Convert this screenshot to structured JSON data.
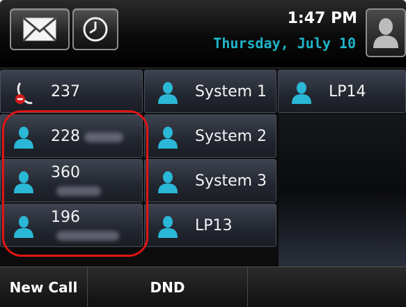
{
  "header": {
    "time": "1:47 PM",
    "date": "Thursday, July 10",
    "icons": [
      "envelope-icon",
      "clock-icon",
      "user-icon"
    ]
  },
  "lines": [
    {
      "label": "237",
      "icon": "handset-missed-icon"
    },
    {
      "label": "System 1",
      "icon": "user-icon"
    },
    {
      "label": "LP14",
      "icon": "user-icon"
    },
    {
      "label": "228",
      "icon": "user-icon"
    },
    {
      "label": "System 2",
      "icon": "user-icon"
    },
    {
      "label": "360",
      "icon": "user-icon"
    },
    {
      "label": "System 3",
      "icon": "user-icon"
    },
    {
      "label": "196",
      "icon": "user-icon"
    },
    {
      "label": "LP13",
      "icon": "user-icon"
    }
  ],
  "softkeys": {
    "new_call": "New Call",
    "dnd": "DND"
  },
  "colors": {
    "accent": "#1fb4c8",
    "highlight": "#e01515",
    "user_icon": "#2bb7d6"
  }
}
